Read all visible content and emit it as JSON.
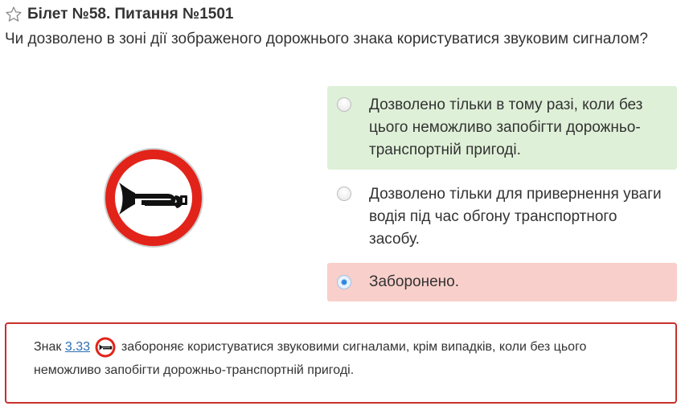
{
  "header": {
    "title": "Білет №58. Питання №1501",
    "icon": "star-outline-icon"
  },
  "question": {
    "text": "Чи дозволено в зоні дії зображеного дорожнього знака користуватися звуковим сигналом?"
  },
  "sign": {
    "icon": "no-horn-sign-icon",
    "colors": {
      "ring": "#e2231a",
      "face": "#ffffff",
      "symbol": "#111111"
    }
  },
  "answers": [
    {
      "text": "Дозволено тільки в тому разі, коли без цього неможливо запобігти дорожньо-транспортній пригоді.",
      "state": "correct",
      "selected": false
    },
    {
      "text": "Дозволено тільки для привернення уваги водія під час обгону транспортного засобу.",
      "state": "none",
      "selected": false
    },
    {
      "text": "Заборонено.",
      "state": "wrong",
      "selected": true
    }
  ],
  "explanation": {
    "prefix": "Знак",
    "link_text": "3.33",
    "suffix": "забороняє користуватися звуковими сигналами, крім випадків, коли без цього неможливо запобігти дорожньо-транспортній пригоді."
  },
  "colors": {
    "correct_bg": "#dff0d8",
    "wrong_bg": "#f8cfca",
    "explain_border": "#c9302c",
    "link": "#2a6fb5"
  }
}
